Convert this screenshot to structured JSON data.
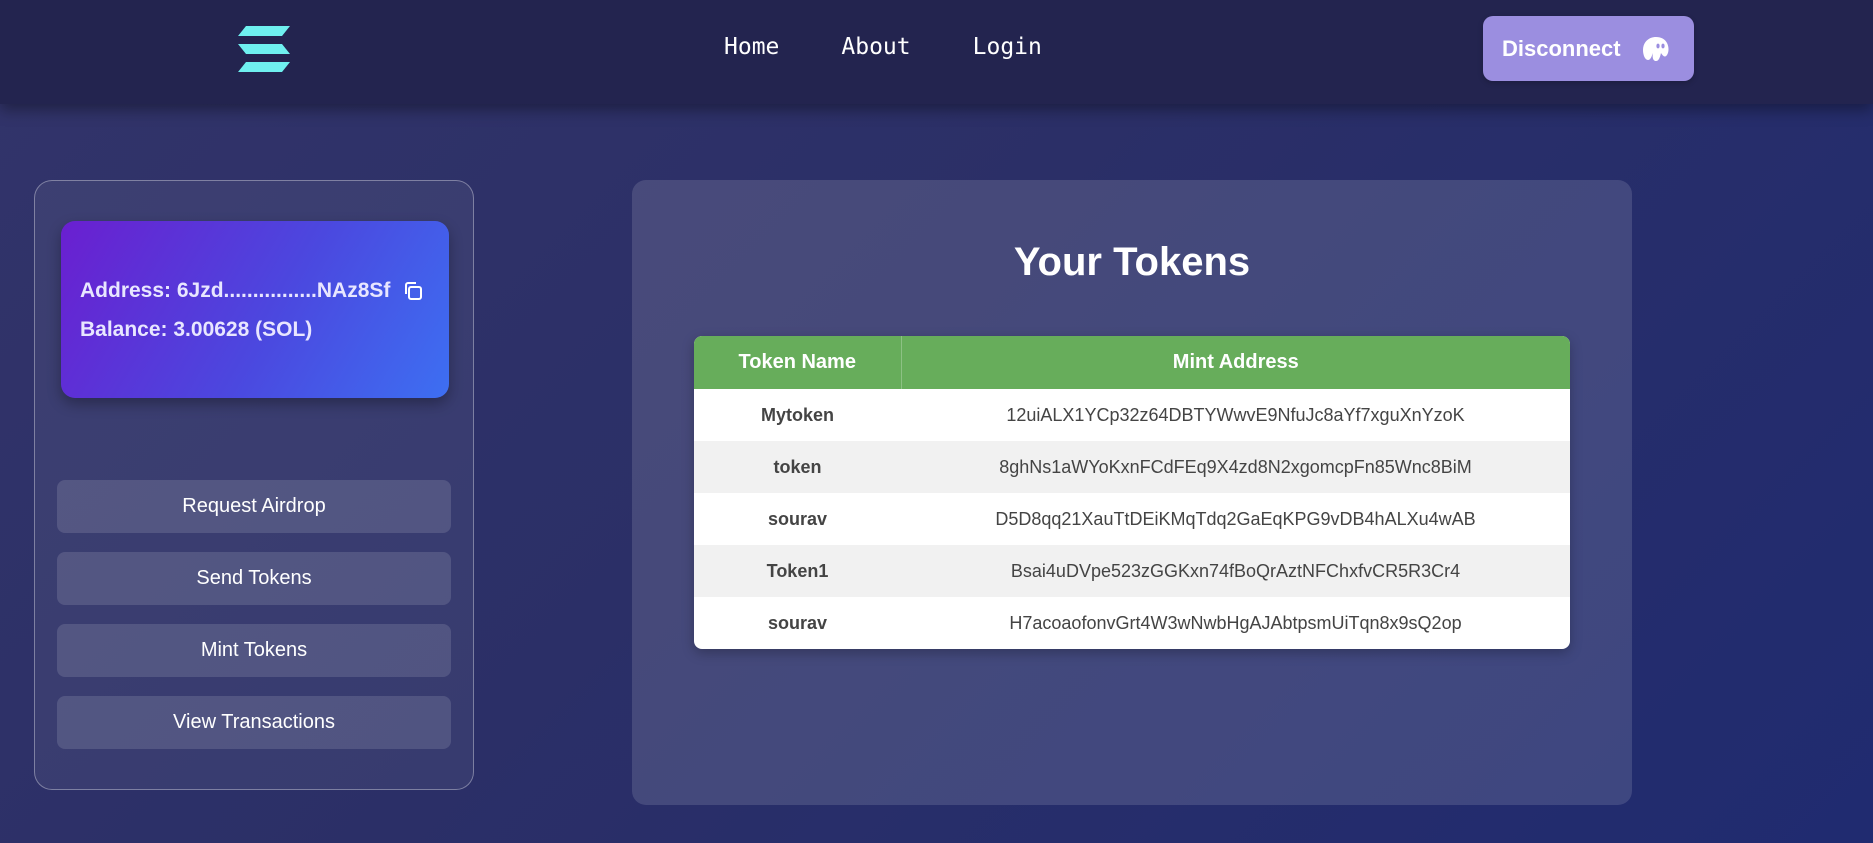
{
  "nav": {
    "links": [
      "Home",
      "About",
      "Login"
    ],
    "disconnect_label": "Disconnect",
    "logo_icon": "solana-logo-icon",
    "wallet_icon": "phantom-ghost-icon"
  },
  "wallet": {
    "address": "Address: 6Jzd................NAz8Sf",
    "balance": "Balance: 3.00628 (SOL)",
    "copy_icon": "copy-icon"
  },
  "sidebar": {
    "buttons": [
      "Request Airdrop",
      "Send Tokens",
      "Mint Tokens",
      "View Transactions"
    ]
  },
  "main": {
    "title": "Your Tokens",
    "table": {
      "headers": [
        "Token Name",
        "Mint Address"
      ],
      "rows": [
        [
          "Mytoken",
          "12uiALX1YCp32z64DBTYWwvE9NfuJc8aYf7xguXnYzoK"
        ],
        [
          "token",
          "8ghNs1aWYoKxnFCdFEq9X4zd8N2xgomcpFn85Wnc8BiM"
        ],
        [
          "sourav",
          "D5D8qq21XauTtDEiKMqTdq2GaEqKPG9vDB4hALXu4wAB"
        ],
        [
          "Token1",
          "Bsai4uDVpe523zGGKxn74fBoQrAztNFChxfvCR5R3Cr4"
        ],
        [
          "sourav",
          "H7acoaofonvGrt4W3wNwbHgAJAbtpsmUiTqn8x9sQ2op"
        ]
      ]
    }
  },
  "colors": {
    "accent_green": "#67ad5b",
    "disconnect_purple": "#9b8ee0",
    "logo_teal": "#6ff0f0"
  }
}
